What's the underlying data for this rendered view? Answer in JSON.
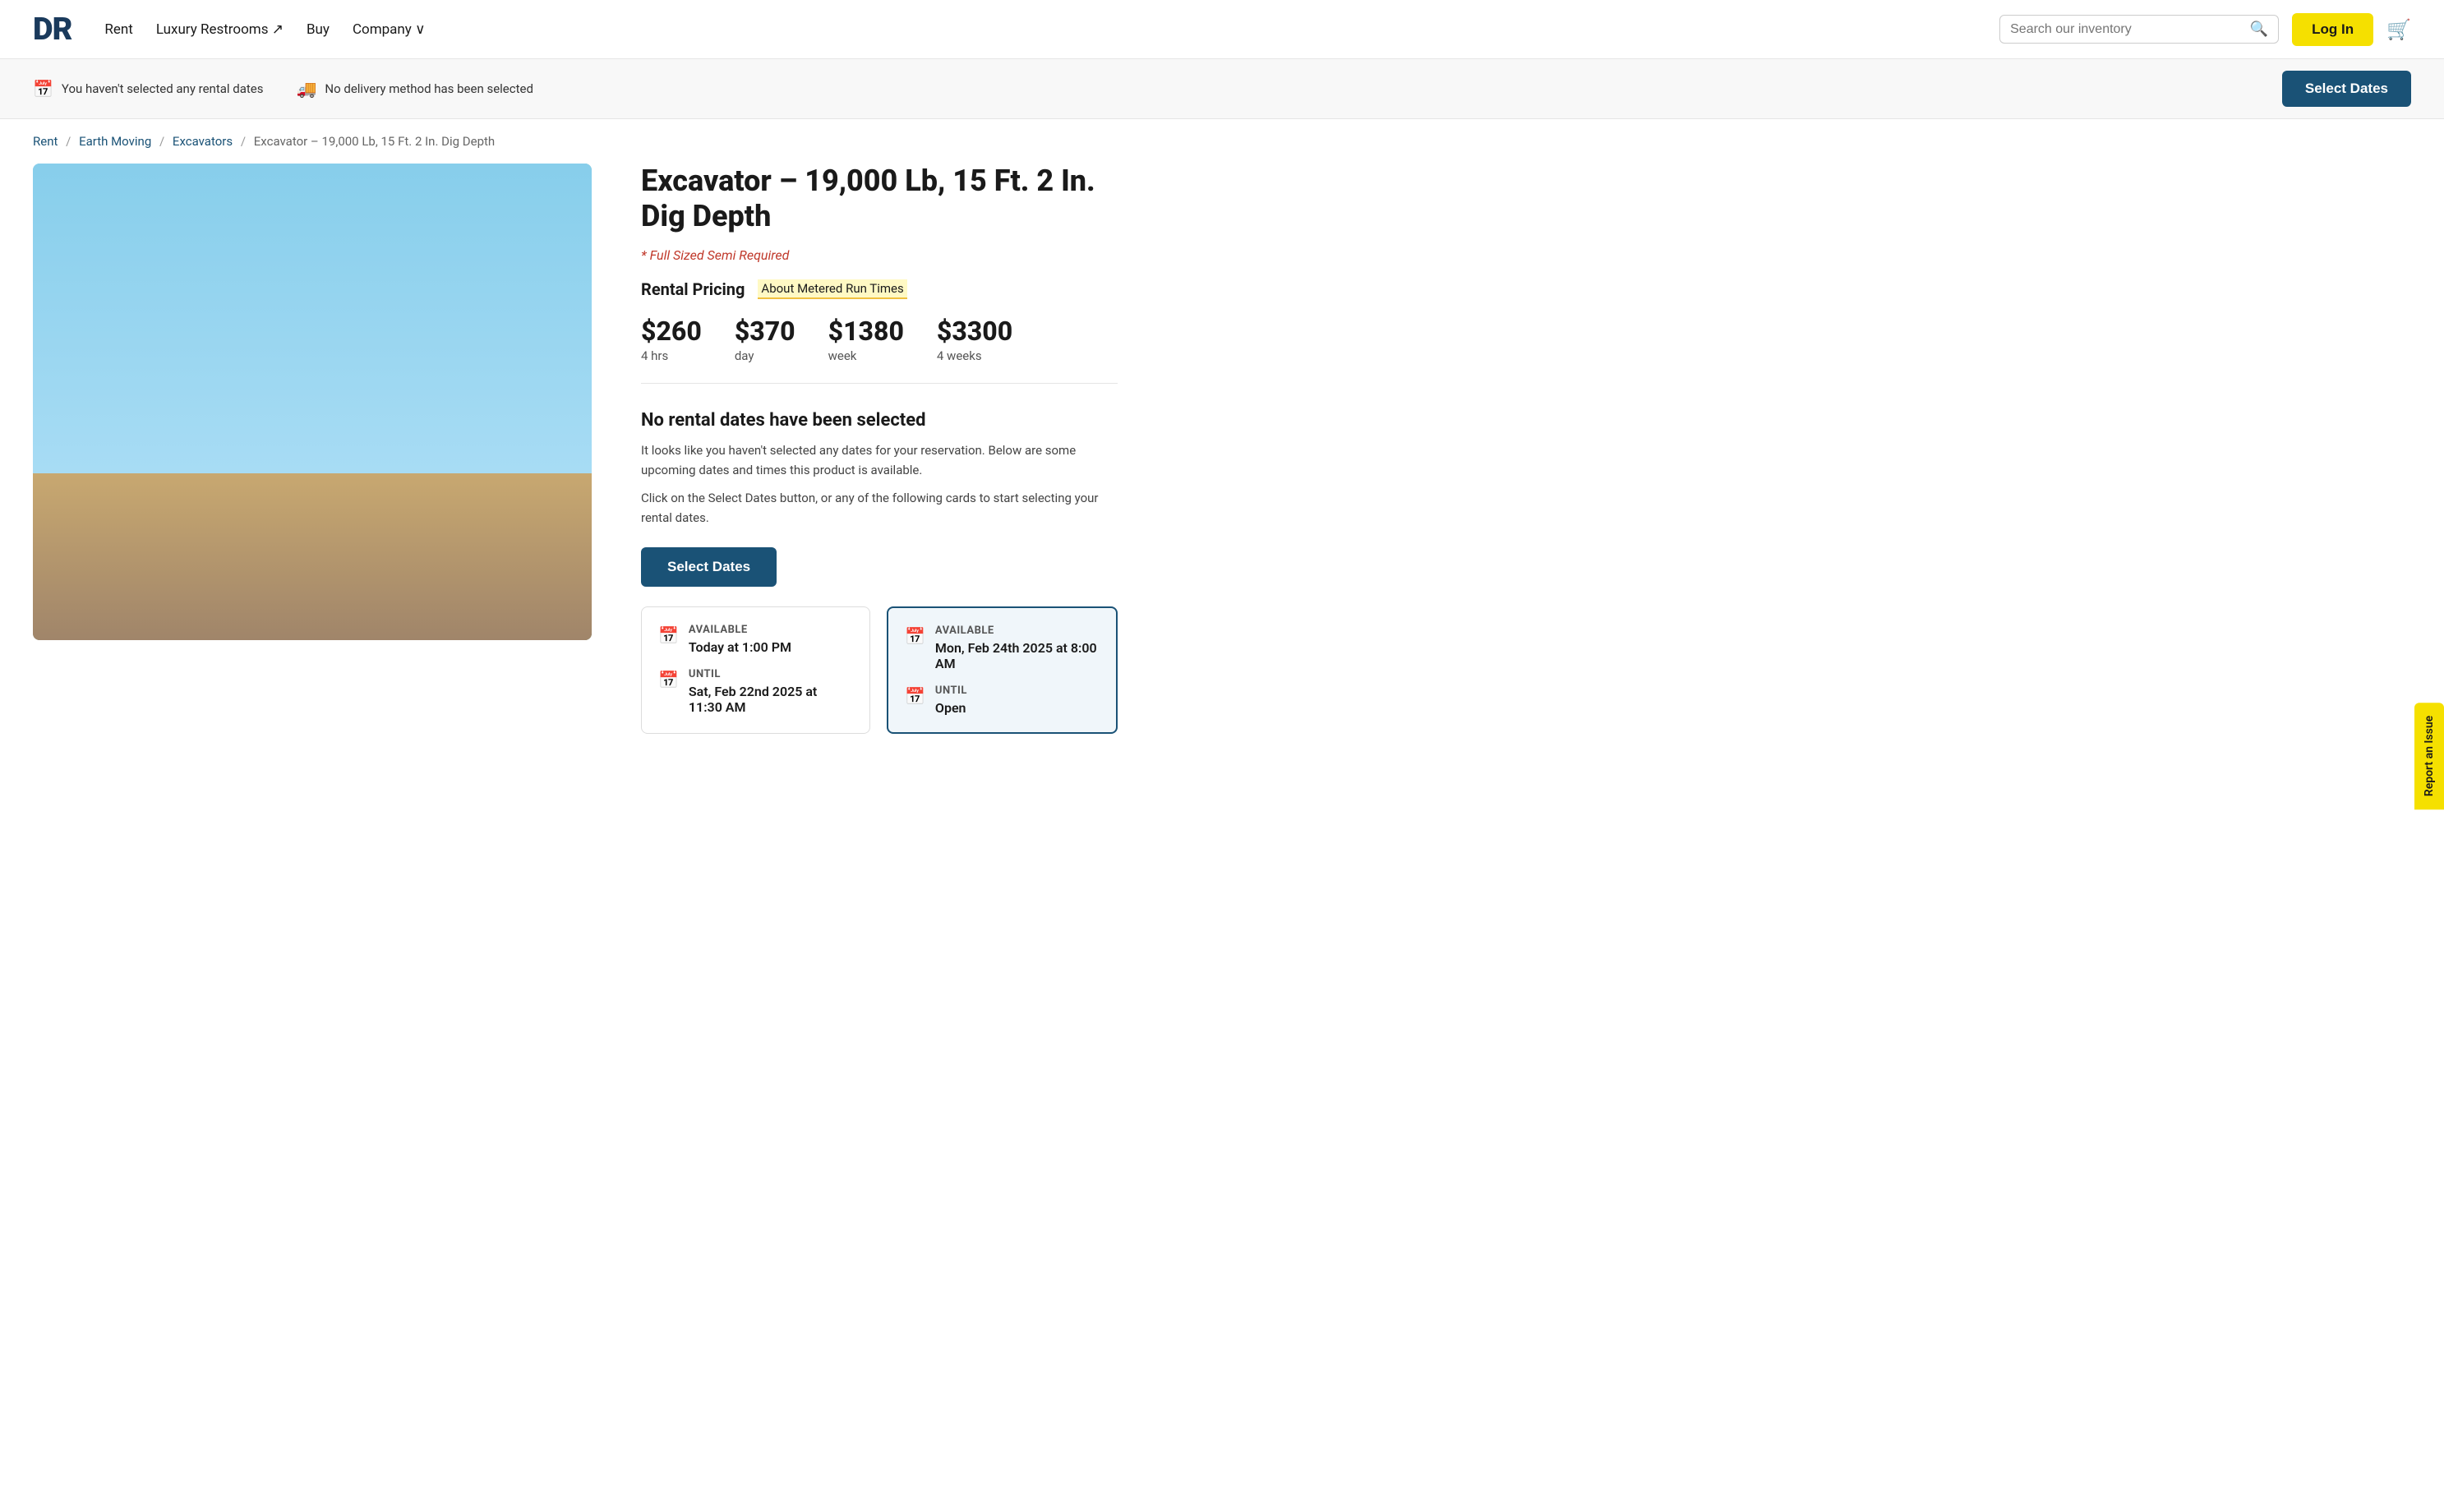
{
  "navbar": {
    "logo": "DR",
    "links": [
      {
        "label": "Rent",
        "id": "rent"
      },
      {
        "label": "Luxury Restrooms ↗",
        "id": "luxury-restrooms"
      },
      {
        "label": "Buy",
        "id": "buy"
      },
      {
        "label": "Company ∨",
        "id": "company"
      }
    ],
    "search_placeholder": "Search our inventory",
    "login_label": "Log In",
    "cart_icon": "🛒"
  },
  "notification_bar": {
    "dates_icon": "📅",
    "dates_message": "You haven't selected any rental dates",
    "delivery_icon": "🚚",
    "delivery_message": "No delivery method has been selected",
    "select_dates_label": "Select Dates"
  },
  "breadcrumb": {
    "items": [
      {
        "label": "Rent",
        "href": "#"
      },
      {
        "label": "Earth Moving",
        "href": "#"
      },
      {
        "label": "Excavators",
        "href": "#"
      },
      {
        "label": "Excavator – 19,000 Lb, 15 Ft. 2 In. Dig Depth",
        "href": null
      }
    ]
  },
  "product": {
    "title": "Excavator – 19,000 Lb, 15 Ft. 2 In. Dig Depth",
    "semi_required": "* Full Sized Semi Required",
    "rental_pricing_label": "Rental Pricing",
    "metered_link_label": "About Metered Run Times",
    "prices": [
      {
        "amount": "$260",
        "period": "4 hrs"
      },
      {
        "amount": "$370",
        "period": "day"
      },
      {
        "amount": "$1380",
        "period": "week"
      },
      {
        "amount": "$3300",
        "period": "4 weeks"
      }
    ],
    "no_dates_title": "No rental dates have been selected",
    "no_dates_text1": "It looks like you haven't selected any dates for your reservation. Below are some upcoming dates and times this product is available.",
    "no_dates_text2": "Click on the Select Dates button, or any of the following cards to start selecting your rental dates.",
    "select_dates_label": "Select Dates",
    "availability": [
      {
        "available_label": "Available",
        "available_value": "Today at 1:00 PM",
        "until_label": "Until",
        "until_value": "Sat, Feb 22nd 2025 at 11:30 AM",
        "selected": false
      },
      {
        "available_label": "Available",
        "available_value": "Mon, Feb 24th 2025 at 8:00 AM",
        "until_label": "Until",
        "until_value": "Open",
        "selected": true
      }
    ]
  },
  "report_issue": {
    "label": "Report an Issue"
  },
  "icons": {
    "search": "🔍",
    "calendar": "📅",
    "delivery": "🚚",
    "cart": "🛒"
  }
}
